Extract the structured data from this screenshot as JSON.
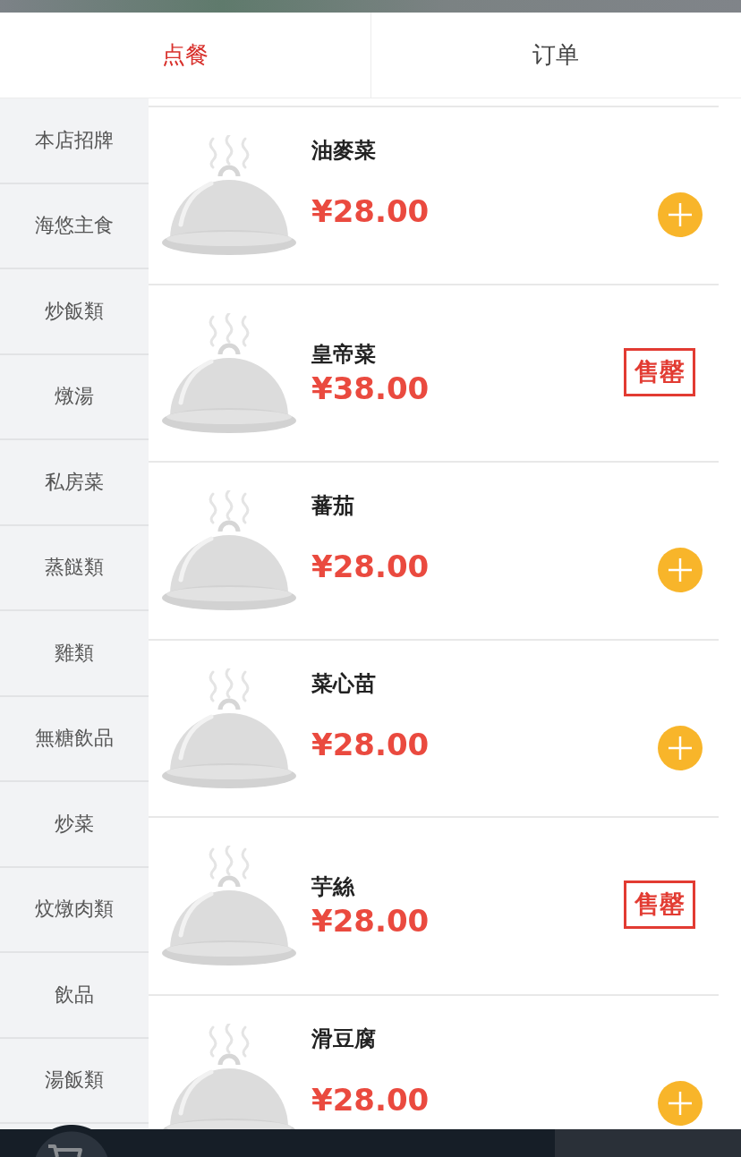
{
  "tabs": [
    {
      "label": "点餐",
      "selected": true
    },
    {
      "label": "订单",
      "selected": false
    }
  ],
  "categories": [
    {
      "label": "本店招牌",
      "selected": false
    },
    {
      "label": "海悠主食",
      "selected": false
    },
    {
      "label": "炒飯類",
      "selected": false
    },
    {
      "label": "燉湯",
      "selected": false
    },
    {
      "label": "私房菜",
      "selected": false
    },
    {
      "label": "蒸餸類",
      "selected": false
    },
    {
      "label": "雞類",
      "selected": false
    },
    {
      "label": "無糖飲品",
      "selected": false
    },
    {
      "label": "炒菜",
      "selected": false
    },
    {
      "label": "炆燉肉類",
      "selected": false
    },
    {
      "label": "飲品",
      "selected": false
    },
    {
      "label": "湯飯類",
      "selected": false
    }
  ],
  "dishes": [
    {
      "name": "油麥菜",
      "price": "¥28.00",
      "sold_out": false
    },
    {
      "name": "皇帝菜",
      "price": "¥38.00",
      "sold_out": true,
      "badge": "售罄"
    },
    {
      "name": "蕃茄",
      "price": "¥28.00",
      "sold_out": false
    },
    {
      "name": "菜心苗",
      "price": "¥28.00",
      "sold_out": false
    },
    {
      "name": "芋絲",
      "price": "¥28.00",
      "sold_out": true,
      "badge": "售罄"
    },
    {
      "name": "滑豆腐",
      "price": "¥28.00",
      "sold_out": false
    }
  ]
}
